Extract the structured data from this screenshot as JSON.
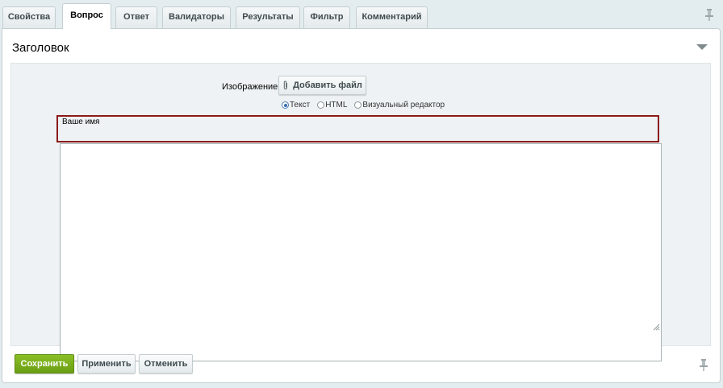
{
  "tabs": [
    {
      "label": "Свойства",
      "active": false
    },
    {
      "label": "Вопрос",
      "active": true
    },
    {
      "label": "Ответ",
      "active": false
    },
    {
      "label": "Валидаторы",
      "active": false
    },
    {
      "label": "Результаты",
      "active": false
    },
    {
      "label": "Фильтр",
      "active": false
    },
    {
      "label": "Комментарий",
      "active": false
    }
  ],
  "panel": {
    "title": "Заголовок",
    "image_label": "Изображение:",
    "add_file_label": "Добавить файл",
    "format_options": [
      {
        "label": "Текст",
        "checked": true
      },
      {
        "label": "HTML",
        "checked": false
      },
      {
        "label": "Визуальный редактор",
        "checked": false
      }
    ],
    "text_value": "Ваше имя"
  },
  "buttons": {
    "save_label": "Сохранить",
    "apply_label": "Применить",
    "cancel_label": "Отменить"
  },
  "colors": {
    "save_green": "#7aae1c",
    "highlight_border": "#8b1a1a",
    "background": "#e3ecee"
  }
}
